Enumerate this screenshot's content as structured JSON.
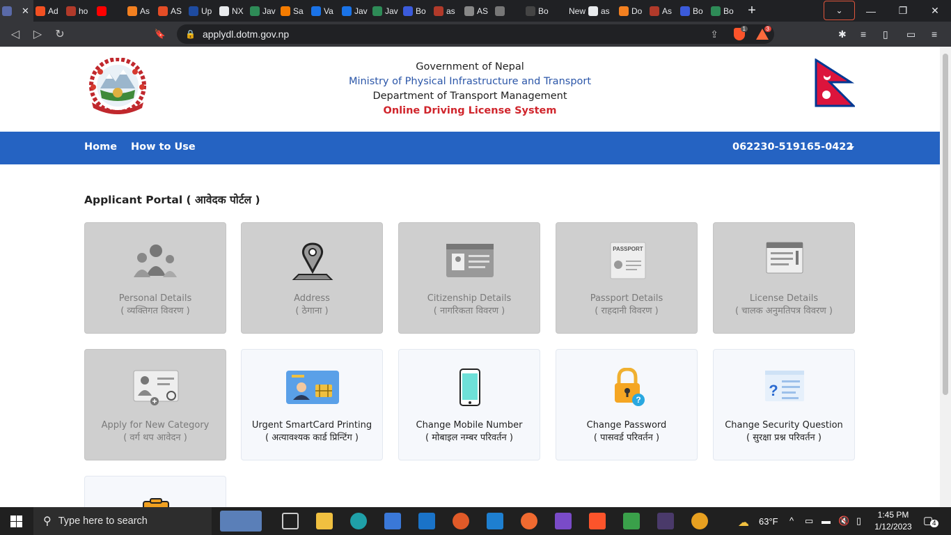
{
  "browser": {
    "tabs": [
      {
        "label": "",
        "color": "#5a6aa8",
        "active": true
      },
      {
        "label": "Ad",
        "color": "#f25022"
      },
      {
        "label": "ho",
        "color": "#b13a2a"
      },
      {
        "label": "",
        "color": "#ff0000"
      },
      {
        "label": "As",
        "color": "#f38020"
      },
      {
        "label": "AS",
        "color": "#e44d26"
      },
      {
        "label": "Up",
        "color": "#1e4ba0"
      },
      {
        "label": "NX",
        "color": "#e8eaed"
      },
      {
        "label": "Jav",
        "color": "#2e8b57"
      },
      {
        "label": "Sa",
        "color": "#f57c00"
      },
      {
        "label": "Va",
        "color": "#1a73e8"
      },
      {
        "label": "Jav",
        "color": "#1a73e8"
      },
      {
        "label": "Jav",
        "color": "#2e8b57"
      },
      {
        "label": "Bo",
        "color": "#3b5bdb"
      },
      {
        "label": "as",
        "color": "#b13a2a"
      },
      {
        "label": "AS",
        "color": "#888888"
      },
      {
        "label": "",
        "color": "#777777"
      },
      {
        "label": "Bo",
        "color": "#444444"
      },
      {
        "label": "New Ta",
        "color": "#202124"
      },
      {
        "label": "as",
        "color": "#e8eaed"
      },
      {
        "label": "Do",
        "color": "#f38020"
      },
      {
        "label": "As",
        "color": "#b13a2a"
      },
      {
        "label": "Bo",
        "color": "#3b5bdb"
      },
      {
        "label": "Bo",
        "color": "#2e8b57"
      }
    ],
    "close_tab": "✕",
    "new_tab": "+",
    "tab_dropdown": "⌄",
    "minimize": "—",
    "restore": "❐",
    "close": "✕",
    "back": "◁",
    "forward": "▷",
    "reload": "↻",
    "bookmark": "🔖",
    "url": "applydl.dotm.gov.np",
    "shield_badge": "1",
    "rewards_badge": "3"
  },
  "header": {
    "line1": "Government of Nepal",
    "line2": "Ministry of Physical Infrastructure and Transport",
    "line3": "Department of Transport Management",
    "line4": "Online Driving License System"
  },
  "nav": {
    "home": "Home",
    "how_to_use": "How to Use",
    "user_id": "062230-519165-0422"
  },
  "portal": {
    "title": "Applicant Portal ( आवेदक पोर्टल )",
    "cards": [
      {
        "en": "Personal Details",
        "np": "( व्यक्तिगत विवरण )",
        "icon": "people-icon",
        "enabled": false
      },
      {
        "en": "Address",
        "np": "( ठेगाना )",
        "icon": "map-pin-icon",
        "enabled": false
      },
      {
        "en": "Citizenship Details",
        "np": "( नागरिकता विवरण )",
        "icon": "id-card-icon",
        "enabled": false
      },
      {
        "en": "Passport Details",
        "np": "( राहदानी विवरण )",
        "icon": "passport-icon",
        "enabled": false
      },
      {
        "en": "License Details",
        "np": "( चालक अनुमतिपत्र विवरण )",
        "icon": "license-icon",
        "enabled": false
      },
      {
        "en": "Apply for New Category",
        "np": "( वर्ग थप आवेदन )",
        "icon": "new-category-icon",
        "enabled": false
      },
      {
        "en": "Urgent SmartCard Printing",
        "np": "( अत्यावश्यक कार्ड प्रिन्टिंग )",
        "icon": "smartcard-icon",
        "enabled": true
      },
      {
        "en": "Change Mobile Number",
        "np": "( मोबाइल नम्बर परिवर्तन )",
        "icon": "mobile-icon",
        "enabled": true
      },
      {
        "en": "Change Password",
        "np": "( पासवर्ड परिवर्तन )",
        "icon": "lock-icon",
        "enabled": true
      },
      {
        "en": "Change Security Question",
        "np": "( सुरक्षा प्रश्न परिवर्तन )",
        "icon": "security-question-icon",
        "enabled": true
      }
    ]
  },
  "taskbar": {
    "search_placeholder": "Type here to search",
    "weather": "63°F",
    "time": "1:45 PM",
    "date": "1/12/2023",
    "notifications": "4"
  }
}
